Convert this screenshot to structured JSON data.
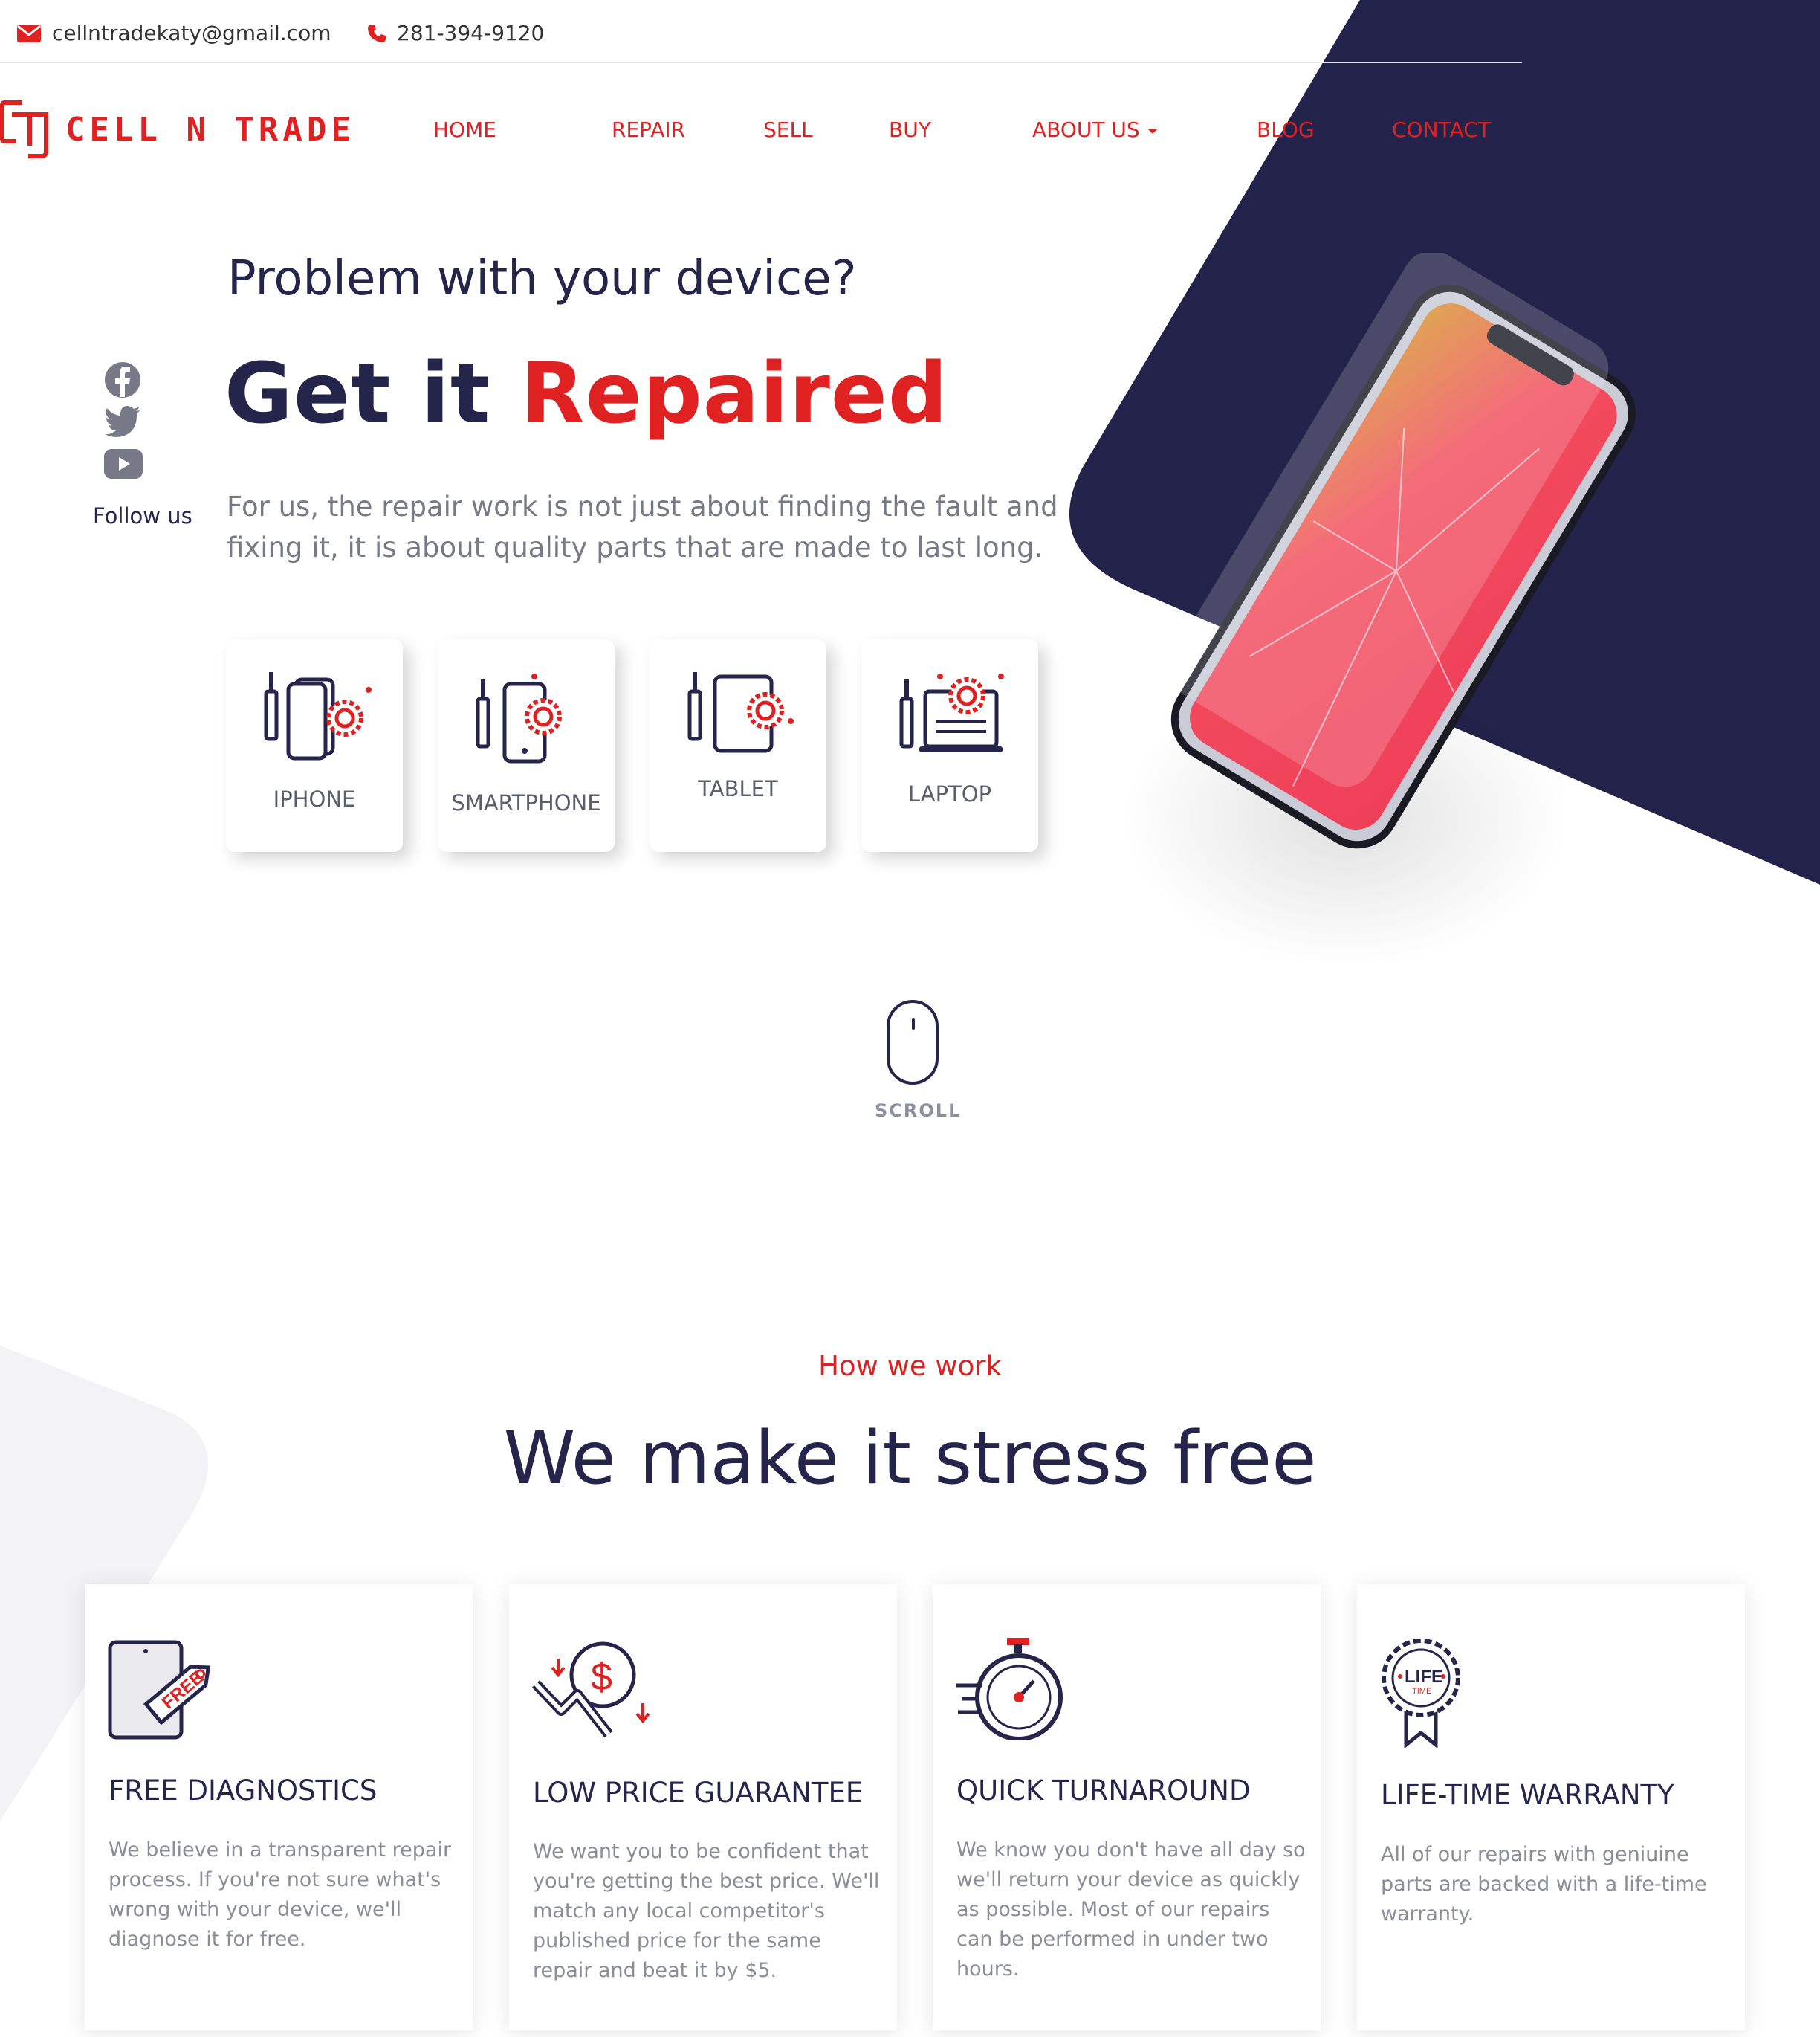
{
  "topbar": {
    "email": "cellntradekaty@gmail.com",
    "phone": "281-394-9120"
  },
  "brand": {
    "logo_text": "CELL N TRADE"
  },
  "nav": {
    "home": "HOME",
    "repair": "REPAIR",
    "sell": "SELL",
    "buy": "BUY",
    "about": "ABOUT US",
    "blog": "BLOG",
    "contact": "CONTACT"
  },
  "hero": {
    "subtitle": "Problem with your device?",
    "title_prefix": "Get it ",
    "title_accent": "Repaired",
    "description": "For us, the repair work is not just about finding the fault and fixing it, it is about quality parts that are made to last long."
  },
  "social": {
    "follow_label": "Follow us",
    "icons": [
      "facebook-icon",
      "twitter-icon",
      "youtube-icon"
    ]
  },
  "devices": [
    {
      "label": "IPHONE",
      "icon": "iphone-repair-icon"
    },
    {
      "label": "SMARTPHONE",
      "icon": "smartphone-repair-icon"
    },
    {
      "label": "TABLET",
      "icon": "tablet-repair-icon"
    },
    {
      "label": "LAPTOP",
      "icon": "laptop-repair-icon"
    }
  ],
  "scroll": {
    "label": "SCROLL"
  },
  "how": {
    "label": "How we work",
    "title": "We make it stress free",
    "features": [
      {
        "title": "FREE DIAGNOSTICS",
        "icon": "free-tag-tablet-icon",
        "icon_text": "FREE",
        "text": "We believe in a transparent repair process. If you're not sure what's wrong with your device, we'll diagnose it for free."
      },
      {
        "title": "LOW PRICE GUARANTEE",
        "icon": "price-drop-icon",
        "icon_text": "$",
        "text": "We want you to be confident that you're getting the best price. We'll match any local competitor's published price for the same repair and beat it by $5."
      },
      {
        "title": "QUICK TURNAROUND",
        "icon": "stopwatch-icon",
        "text": "We know you don't have all day so we'll return your device as quickly as possible. Most of our repairs can be performed in under two hours."
      },
      {
        "title": "LIFE-TIME WARRANTY",
        "icon": "lifetime-badge-icon",
        "icon_text": "LIFE",
        "icon_subtext": "TIME",
        "text": "All of our repairs with geniuine parts are backed with a life-time warranty."
      }
    ]
  },
  "colors": {
    "accent": "#e02121",
    "navy": "#25244a",
    "muted_text": "#777a86"
  }
}
